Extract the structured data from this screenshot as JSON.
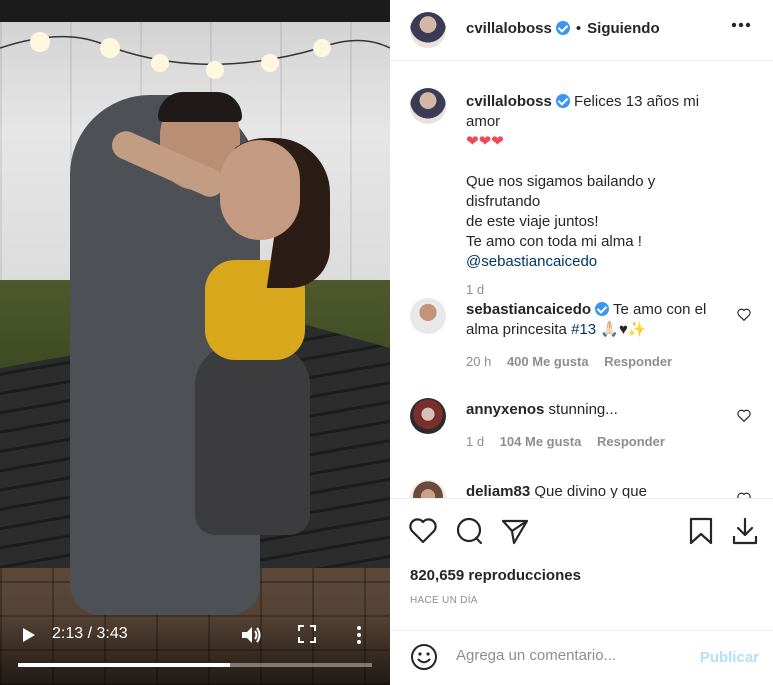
{
  "video": {
    "time": "2:13 / 3:43",
    "progress_fraction": 0.6
  },
  "header": {
    "username": "cvillaloboss",
    "separator": "•",
    "follow_status": "Siguiendo"
  },
  "caption": {
    "username": "cvillaloboss",
    "text_line1": "Felices 13 años mi amor",
    "hearts": "❤❤❤",
    "paragraph_line1": "Que nos sigamos bailando y disfrutando",
    "paragraph_line2": "de este viaje juntos!",
    "paragraph_line3": "Te amo con toda mi alma !",
    "mention": "@sebastiancaicedo",
    "age": "1 d"
  },
  "comments": [
    {
      "username": "sebastiancaicedo",
      "verified": true,
      "text_a": "Te amo con el",
      "text_b": "alma princesita",
      "hashtag": "#13",
      "emojis": "🙏🏻♥✨",
      "age": "20 h",
      "likes": "400 Me gusta",
      "reply": "Responder"
    },
    {
      "username": "annyxenos",
      "verified": false,
      "text": "stunning...",
      "age": "1 d",
      "likes": "104 Me gusta",
      "reply": "Responder"
    },
    {
      "username": "deliam83",
      "verified": false,
      "text": "Que divino y que"
    }
  ],
  "stats": {
    "views": "820,659 reproducciones",
    "posted": "HACE UN DÍA"
  },
  "add_comment": {
    "placeholder": "Agrega un comentario...",
    "publish_label": "Publicar"
  },
  "colors": {
    "link": "#00376b",
    "verified": "#3897f0",
    "muted": "#8e8e8e",
    "publish_disabled": "#b2dffc",
    "heart_red": "#ed4956"
  }
}
